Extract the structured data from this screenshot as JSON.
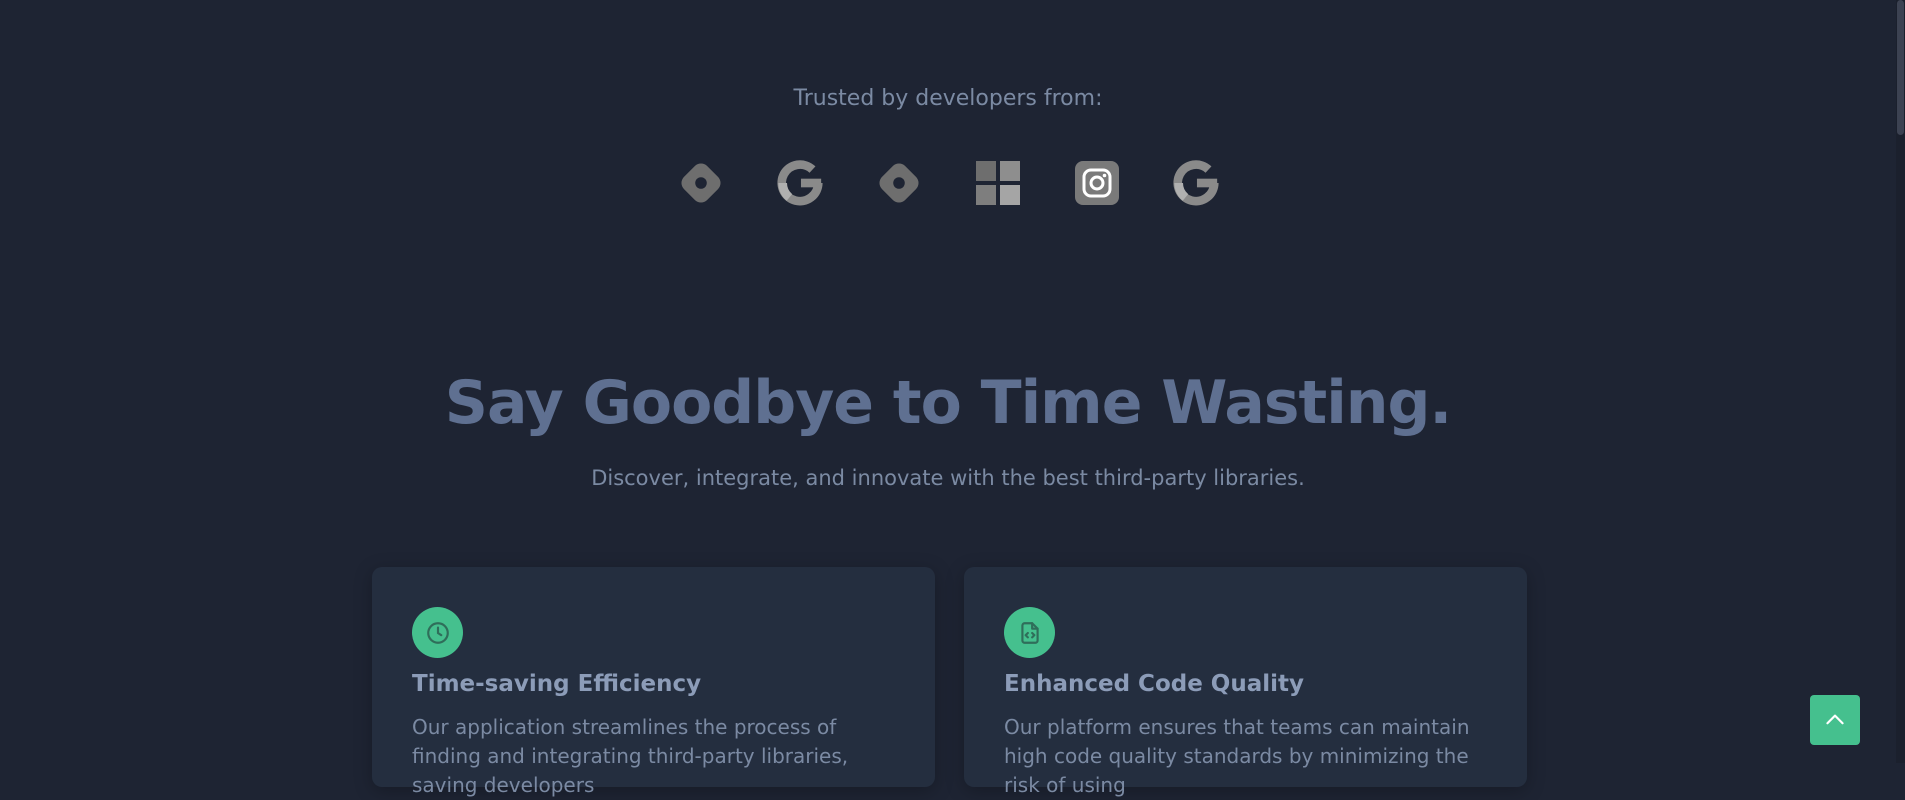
{
  "trusted": {
    "label": "Trusted by developers from:"
  },
  "logos": [
    {
      "icon": "diamond-logo-icon"
    },
    {
      "icon": "google-logo-icon"
    },
    {
      "icon": "diamond-logo-icon"
    },
    {
      "icon": "windows-logo-icon"
    },
    {
      "icon": "instagram-logo-icon"
    },
    {
      "icon": "google-logo-icon"
    }
  ],
  "hero": {
    "headline": "Say Goodbye to Time Wasting.",
    "subhead": "Discover, integrate, and innovate with the best third-party libraries."
  },
  "features": [
    {
      "icon": "clock-icon",
      "title": "Time-saving Efficiency",
      "text": "Our application streamlines the process of finding and integrating third-party libraries, saving developers"
    },
    {
      "icon": "code-file-icon",
      "title": "Enhanced Code Quality",
      "text": "Our platform ensures that teams can maintain high code quality standards by minimizing the risk of using"
    }
  ],
  "colors": {
    "background": "#1e2433",
    "card": "#242e3f",
    "accent": "#45c08e",
    "headline": "#5f7091",
    "text": "#7b8aa3"
  },
  "back_to_top": {
    "icon": "chevron-up-icon"
  }
}
